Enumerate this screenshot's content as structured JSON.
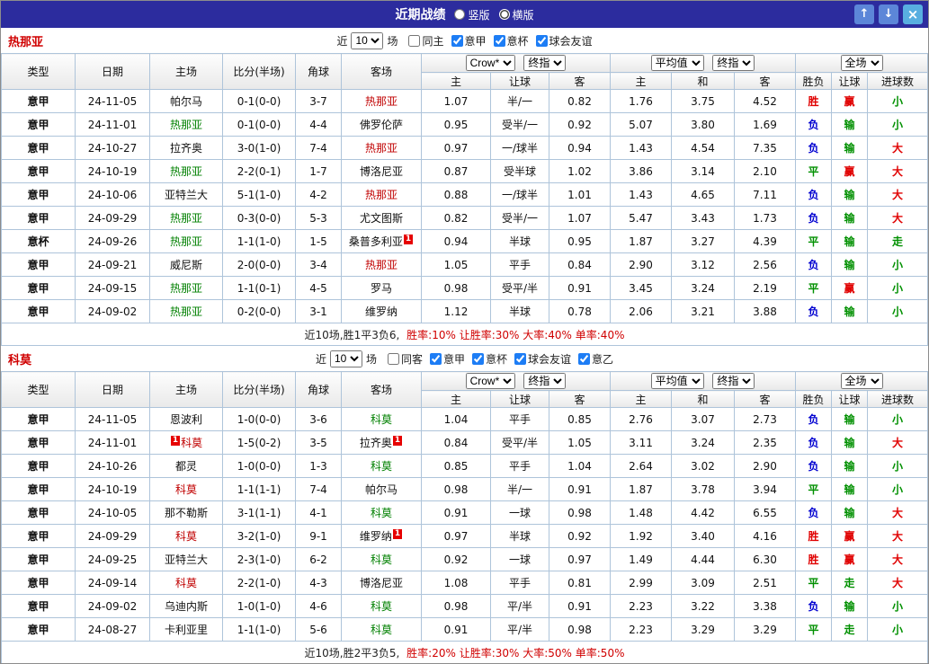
{
  "titlebar": {
    "title": "近期战绩",
    "radios": [
      {
        "label": "竖版",
        "selected": false
      },
      {
        "label": "横版",
        "selected": true
      }
    ],
    "buttons": {
      "up": "↑",
      "down": "↓",
      "close": "×"
    }
  },
  "sections": [
    {
      "team": "热那亚",
      "filter": {
        "near": "近",
        "count": "10",
        "games": "场",
        "checkboxes": [
          {
            "label": "同主",
            "checked": false
          },
          {
            "label": "意甲",
            "checked": true
          },
          {
            "label": "意杯",
            "checked": true
          },
          {
            "label": "球会友谊",
            "checked": true
          }
        ]
      },
      "table": {
        "cols": [
          "类型",
          "日期",
          "主场",
          "比分(半场)",
          "角球",
          "客场"
        ],
        "selects": [
          "Crow*",
          "终指",
          "平均值",
          "终指",
          "全场"
        ],
        "sub": [
          "主",
          "让球",
          "客",
          "主",
          "和",
          "客",
          "胜负",
          "让球",
          "进球数"
        ],
        "rows": [
          {
            "type": "意甲",
            "type_c": "blue",
            "date": "24-11-05",
            "home": {
              "t": "帕尔马",
              "c": "black"
            },
            "score": "0-1(0-0)",
            "corners": "3-7",
            "away": {
              "t": "热那亚",
              "c": "red"
            },
            "odds": [
              "1.07",
              "半/一",
              "0.82"
            ],
            "avg": [
              "1.76",
              "3.75",
              "4.52"
            ],
            "result": {
              "t": "胜",
              "c": "red"
            },
            "handicap": {
              "t": "赢",
              "c": "red"
            },
            "goals": {
              "t": "小",
              "c": "green"
            }
          },
          {
            "type": "意甲",
            "type_c": "blue",
            "date": "24-11-01",
            "home": {
              "t": "热那亚",
              "c": "green"
            },
            "score": "0-1(0-0)",
            "corners": "4-4",
            "away": {
              "t": "佛罗伦萨",
              "c": "black"
            },
            "odds": [
              "0.95",
              "受半/一",
              "0.92"
            ],
            "avg": [
              "5.07",
              "3.80",
              "1.69"
            ],
            "result": {
              "t": "负",
              "c": "blue"
            },
            "handicap": {
              "t": "输",
              "c": "green"
            },
            "goals": {
              "t": "小",
              "c": "green"
            }
          },
          {
            "type": "意甲",
            "type_c": "blue",
            "date": "24-10-27",
            "home": {
              "t": "拉齐奥",
              "c": "black"
            },
            "score": "3-0(1-0)",
            "corners": "7-4",
            "away": {
              "t": "热那亚",
              "c": "red"
            },
            "odds": [
              "0.97",
              "一/球半",
              "0.94"
            ],
            "avg": [
              "1.43",
              "4.54",
              "7.35"
            ],
            "result": {
              "t": "负",
              "c": "blue"
            },
            "handicap": {
              "t": "输",
              "c": "green"
            },
            "goals": {
              "t": "大",
              "c": "red"
            }
          },
          {
            "type": "意甲",
            "type_c": "blue",
            "date": "24-10-19",
            "home": {
              "t": "热那亚",
              "c": "green"
            },
            "score": "2-2(0-1)",
            "corners": "1-7",
            "away": {
              "t": "博洛尼亚",
              "c": "black"
            },
            "odds": [
              "0.87",
              "受半球",
              "1.02"
            ],
            "avg": [
              "3.86",
              "3.14",
              "2.10"
            ],
            "result": {
              "t": "平",
              "c": "green"
            },
            "handicap": {
              "t": "赢",
              "c": "red"
            },
            "goals": {
              "t": "大",
              "c": "red"
            }
          },
          {
            "type": "意甲",
            "type_c": "blue",
            "date": "24-10-06",
            "home": {
              "t": "亚特兰大",
              "c": "black"
            },
            "score": "5-1(1-0)",
            "corners": "4-2",
            "away": {
              "t": "热那亚",
              "c": "red"
            },
            "odds": [
              "0.88",
              "一/球半",
              "1.01"
            ],
            "avg": [
              "1.43",
              "4.65",
              "7.11"
            ],
            "result": {
              "t": "负",
              "c": "blue"
            },
            "handicap": {
              "t": "输",
              "c": "green"
            },
            "goals": {
              "t": "大",
              "c": "red"
            }
          },
          {
            "type": "意甲",
            "type_c": "blue",
            "date": "24-09-29",
            "home": {
              "t": "热那亚",
              "c": "green"
            },
            "score": "0-3(0-0)",
            "corners": "5-3",
            "away": {
              "t": "尤文图斯",
              "c": "black"
            },
            "odds": [
              "0.82",
              "受半/一",
              "1.07"
            ],
            "avg": [
              "5.47",
              "3.43",
              "1.73"
            ],
            "result": {
              "t": "负",
              "c": "blue"
            },
            "handicap": {
              "t": "输",
              "c": "green"
            },
            "goals": {
              "t": "大",
              "c": "red"
            }
          },
          {
            "type": "意杯",
            "type_c": "purple",
            "date": "24-09-26",
            "home": {
              "t": "热那亚",
              "c": "green"
            },
            "score": "1-1(1-0)",
            "corners": "1-5",
            "away": {
              "t": "桑普多利亚",
              "c": "black",
              "badge": "1",
              "badge_pos": "after"
            },
            "odds": [
              "0.94",
              "半球",
              "0.95"
            ],
            "avg": [
              "1.87",
              "3.27",
              "4.39"
            ],
            "result": {
              "t": "平",
              "c": "green"
            },
            "handicap": {
              "t": "输",
              "c": "green"
            },
            "goals": {
              "t": "走",
              "c": "green"
            }
          },
          {
            "type": "意甲",
            "type_c": "blue",
            "date": "24-09-21",
            "home": {
              "t": "威尼斯",
              "c": "black"
            },
            "score": "2-0(0-0)",
            "corners": "3-4",
            "away": {
              "t": "热那亚",
              "c": "red"
            },
            "odds": [
              "1.05",
              "平手",
              "0.84"
            ],
            "avg": [
              "2.90",
              "3.12",
              "2.56"
            ],
            "result": {
              "t": "负",
              "c": "blue"
            },
            "handicap": {
              "t": "输",
              "c": "green"
            },
            "goals": {
              "t": "小",
              "c": "green"
            }
          },
          {
            "type": "意甲",
            "type_c": "blue",
            "date": "24-09-15",
            "home": {
              "t": "热那亚",
              "c": "green"
            },
            "score": "1-1(0-1)",
            "corners": "4-5",
            "away": {
              "t": "罗马",
              "c": "black"
            },
            "odds": [
              "0.98",
              "受平/半",
              "0.91"
            ],
            "avg": [
              "3.45",
              "3.24",
              "2.19"
            ],
            "result": {
              "t": "平",
              "c": "green"
            },
            "handicap": {
              "t": "赢",
              "c": "red"
            },
            "goals": {
              "t": "小",
              "c": "green"
            }
          },
          {
            "type": "意甲",
            "type_c": "blue",
            "date": "24-09-02",
            "home": {
              "t": "热那亚",
              "c": "green"
            },
            "score": "0-2(0-0)",
            "corners": "3-1",
            "away": {
              "t": "维罗纳",
              "c": "black"
            },
            "odds": [
              "1.12",
              "半球",
              "0.78"
            ],
            "avg": [
              "2.06",
              "3.21",
              "3.88"
            ],
            "result": {
              "t": "负",
              "c": "blue"
            },
            "handicap": {
              "t": "输",
              "c": "green"
            },
            "goals": {
              "t": "小",
              "c": "green"
            }
          }
        ]
      },
      "summary": {
        "text": "近10场,胜1平3负6,",
        "stats": "胜率:10% 让胜率:30% 大率:40% 单率:40%"
      }
    },
    {
      "team": "科莫",
      "filter": {
        "near": "近",
        "count": "10",
        "games": "场",
        "checkboxes": [
          {
            "label": "同客",
            "checked": false
          },
          {
            "label": "意甲",
            "checked": true
          },
          {
            "label": "意杯",
            "checked": true
          },
          {
            "label": "球会友谊",
            "checked": true
          },
          {
            "label": "意乙",
            "checked": true
          }
        ]
      },
      "table": {
        "cols": [
          "类型",
          "日期",
          "主场",
          "比分(半场)",
          "角球",
          "客场"
        ],
        "selects": [
          "Crow*",
          "终指",
          "平均值",
          "终指",
          "全场"
        ],
        "sub": [
          "主",
          "让球",
          "客",
          "主",
          "和",
          "客",
          "胜负",
          "让球",
          "进球数"
        ],
        "rows": [
          {
            "type": "意甲",
            "type_c": "blue",
            "date": "24-11-05",
            "home": {
              "t": "恩波利",
              "c": "black"
            },
            "score": "1-0(0-0)",
            "corners": "3-6",
            "away": {
              "t": "科莫",
              "c": "green"
            },
            "odds": [
              "1.04",
              "平手",
              "0.85"
            ],
            "avg": [
              "2.76",
              "3.07",
              "2.73"
            ],
            "result": {
              "t": "负",
              "c": "blue"
            },
            "handicap": {
              "t": "输",
              "c": "green"
            },
            "goals": {
              "t": "小",
              "c": "green"
            }
          },
          {
            "type": "意甲",
            "type_c": "blue",
            "date": "24-11-01",
            "home": {
              "t": "科莫",
              "c": "red",
              "badge": "1",
              "badge_pos": "before"
            },
            "score": "1-5(0-2)",
            "corners": "3-5",
            "away": {
              "t": "拉齐奥",
              "c": "black",
              "badge": "1",
              "badge_pos": "after"
            },
            "odds": [
              "0.84",
              "受平/半",
              "1.05"
            ],
            "avg": [
              "3.11",
              "3.24",
              "2.35"
            ],
            "result": {
              "t": "负",
              "c": "blue"
            },
            "handicap": {
              "t": "输",
              "c": "green"
            },
            "goals": {
              "t": "大",
              "c": "red"
            }
          },
          {
            "type": "意甲",
            "type_c": "blue",
            "date": "24-10-26",
            "home": {
              "t": "都灵",
              "c": "black"
            },
            "score": "1-0(0-0)",
            "corners": "1-3",
            "away": {
              "t": "科莫",
              "c": "green"
            },
            "odds": [
              "0.85",
              "平手",
              "1.04"
            ],
            "avg": [
              "2.64",
              "3.02",
              "2.90"
            ],
            "result": {
              "t": "负",
              "c": "blue"
            },
            "handicap": {
              "t": "输",
              "c": "green"
            },
            "goals": {
              "t": "小",
              "c": "green"
            }
          },
          {
            "type": "意甲",
            "type_c": "blue",
            "date": "24-10-19",
            "home": {
              "t": "科莫",
              "c": "red"
            },
            "score": "1-1(1-1)",
            "corners": "7-4",
            "away": {
              "t": "帕尔马",
              "c": "black"
            },
            "odds": [
              "0.98",
              "半/一",
              "0.91"
            ],
            "avg": [
              "1.87",
              "3.78",
              "3.94"
            ],
            "result": {
              "t": "平",
              "c": "green"
            },
            "handicap": {
              "t": "输",
              "c": "green"
            },
            "goals": {
              "t": "小",
              "c": "green"
            }
          },
          {
            "type": "意甲",
            "type_c": "blue",
            "date": "24-10-05",
            "home": {
              "t": "那不勒斯",
              "c": "black"
            },
            "score": "3-1(1-1)",
            "corners": "4-1",
            "away": {
              "t": "科莫",
              "c": "green"
            },
            "odds": [
              "0.91",
              "一球",
              "0.98"
            ],
            "avg": [
              "1.48",
              "4.42",
              "6.55"
            ],
            "result": {
              "t": "负",
              "c": "blue"
            },
            "handicap": {
              "t": "输",
              "c": "green"
            },
            "goals": {
              "t": "大",
              "c": "red"
            }
          },
          {
            "type": "意甲",
            "type_c": "blue",
            "date": "24-09-29",
            "home": {
              "t": "科莫",
              "c": "red"
            },
            "score": "3-2(1-0)",
            "corners": "9-1",
            "away": {
              "t": "维罗纳",
              "c": "black",
              "badge": "1",
              "badge_pos": "after"
            },
            "odds": [
              "0.97",
              "半球",
              "0.92"
            ],
            "avg": [
              "1.92",
              "3.40",
              "4.16"
            ],
            "result": {
              "t": "胜",
              "c": "red"
            },
            "handicap": {
              "t": "赢",
              "c": "red"
            },
            "goals": {
              "t": "大",
              "c": "red"
            }
          },
          {
            "type": "意甲",
            "type_c": "blue",
            "date": "24-09-25",
            "home": {
              "t": "亚特兰大",
              "c": "black"
            },
            "score": "2-3(1-0)",
            "corners": "6-2",
            "away": {
              "t": "科莫",
              "c": "green"
            },
            "odds": [
              "0.92",
              "一球",
              "0.97"
            ],
            "avg": [
              "1.49",
              "4.44",
              "6.30"
            ],
            "result": {
              "t": "胜",
              "c": "red"
            },
            "handicap": {
              "t": "赢",
              "c": "red"
            },
            "goals": {
              "t": "大",
              "c": "red"
            }
          },
          {
            "type": "意甲",
            "type_c": "blue",
            "date": "24-09-14",
            "home": {
              "t": "科莫",
              "c": "red"
            },
            "score": "2-2(1-0)",
            "corners": "4-3",
            "away": {
              "t": "博洛尼亚",
              "c": "black"
            },
            "odds": [
              "1.08",
              "平手",
              "0.81"
            ],
            "avg": [
              "2.99",
              "3.09",
              "2.51"
            ],
            "result": {
              "t": "平",
              "c": "green"
            },
            "handicap": {
              "t": "走",
              "c": "green"
            },
            "goals": {
              "t": "大",
              "c": "red"
            }
          },
          {
            "type": "意甲",
            "type_c": "blue",
            "date": "24-09-02",
            "home": {
              "t": "乌迪内斯",
              "c": "black"
            },
            "score": "1-0(1-0)",
            "corners": "4-6",
            "away": {
              "t": "科莫",
              "c": "green"
            },
            "odds": [
              "0.98",
              "平/半",
              "0.91"
            ],
            "avg": [
              "2.23",
              "3.22",
              "3.38"
            ],
            "result": {
              "t": "负",
              "c": "blue"
            },
            "handicap": {
              "t": "输",
              "c": "green"
            },
            "goals": {
              "t": "小",
              "c": "green"
            }
          },
          {
            "type": "意甲",
            "type_c": "blue",
            "date": "24-08-27",
            "home": {
              "t": "卡利亚里",
              "c": "black"
            },
            "score": "1-1(1-0)",
            "corners": "5-6",
            "away": {
              "t": "科莫",
              "c": "green"
            },
            "odds": [
              "0.91",
              "平/半",
              "0.98"
            ],
            "avg": [
              "2.23",
              "3.29",
              "3.29"
            ],
            "result": {
              "t": "平",
              "c": "green"
            },
            "handicap": {
              "t": "走",
              "c": "green"
            },
            "goals": {
              "t": "小",
              "c": "green"
            }
          }
        ]
      },
      "summary": {
        "text": "近10场,胜2平3负5,",
        "stats": "胜率:20% 让胜率:30% 大率:50% 单率:50%"
      }
    }
  ]
}
